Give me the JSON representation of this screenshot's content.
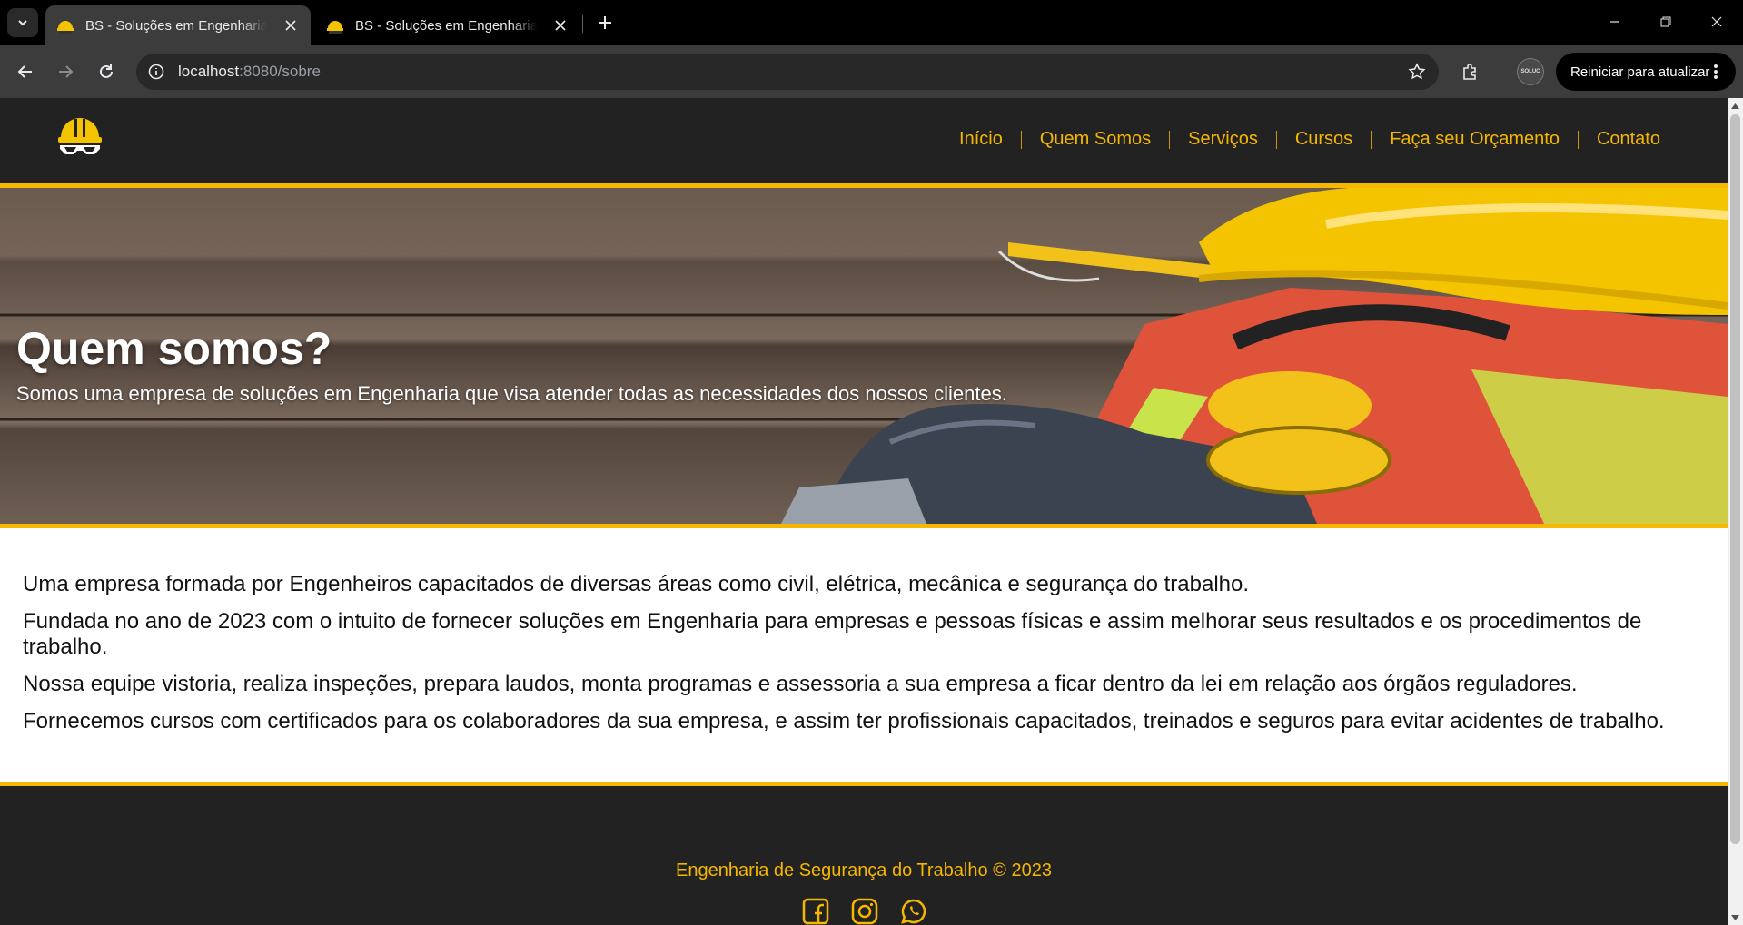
{
  "browser": {
    "tabs": [
      {
        "title": "BS - Soluções em Engenharia e Segurança",
        "active": true
      },
      {
        "title": "BS - Soluções em Engenharia e Segurança",
        "active": false
      }
    ],
    "url_host": "localhost",
    "url_rest": ":8080/sobre",
    "profile_label": "SOLUC",
    "update_button": "Reiniciar para atualizar"
  },
  "site": {
    "nav": [
      "Início",
      "Quem Somos",
      "Serviços",
      "Cursos",
      "Faça seu Orçamento",
      "Contato"
    ],
    "hero": {
      "title": "Quem somos?",
      "subtitle": "Somos uma empresa de soluções em Engenharia que visa atender todas as necessidades dos nossos clientes."
    },
    "paragraphs": [
      "Uma empresa formada por Engenheiros capacitados de diversas áreas como civil, elétrica, mecânica e segurança do trabalho.",
      "Fundada no ano de 2023 com o intuito de fornecer soluções em Engenharia para empresas e pessoas físicas e assim melhorar seus resultados e os procedimentos de trabalho.",
      "Nossa equipe vistoria, realiza inspeções, prepara laudos, monta programas e assessoria a sua empresa a ficar dentro da lei em relação aos órgãos reguladores.",
      "Fornecemos cursos com certificados para os colaboradores da sua empresa, e assim ter profissionais capacitados, treinados e seguros para evitar acidentes de trabalho."
    ],
    "footer": {
      "text": "Engenharia de Segurança do Trabalho © 2023",
      "social_icons": [
        "facebook-icon",
        "instagram-icon",
        "whatsapp-icon"
      ]
    }
  },
  "colors": {
    "accent": "#f5b700",
    "header_bg": "#222222",
    "chrome_bg": "#3c3c3c"
  }
}
